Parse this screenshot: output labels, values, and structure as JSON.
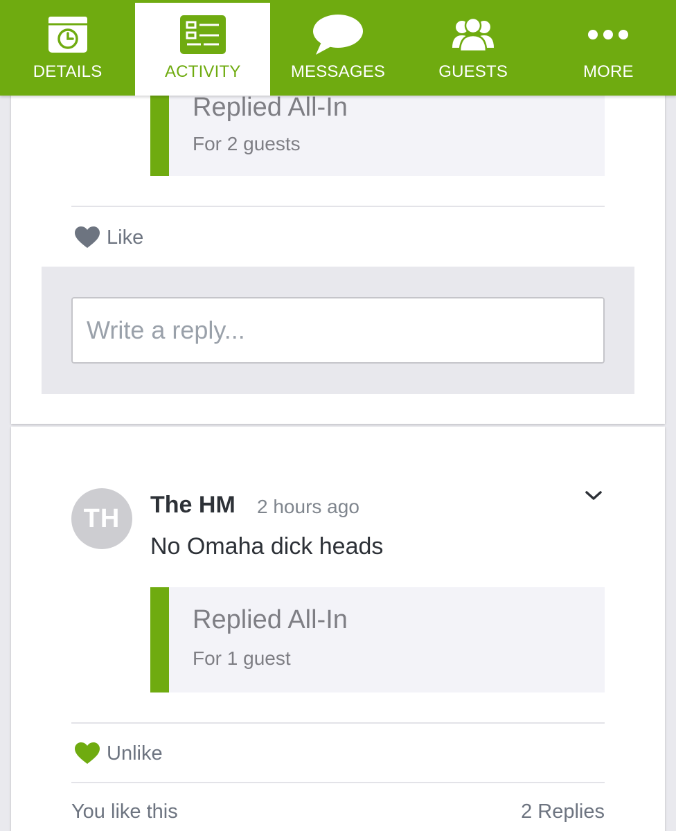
{
  "colors": {
    "brand_green": "#6fab10",
    "status_bg": "#f3f3f8",
    "muted_text": "#7e7e84"
  },
  "nav": {
    "tabs": [
      {
        "label": "DETAILS",
        "icon": "calendar-clock-icon",
        "active": false
      },
      {
        "label": "ACTIVITY",
        "icon": "activity-feed-icon",
        "active": true
      },
      {
        "label": "MESSAGES",
        "icon": "speech-bubble-icon",
        "active": false
      },
      {
        "label": "GUESTS",
        "icon": "guests-group-icon",
        "active": false
      },
      {
        "label": "MORE",
        "icon": "more-dots-icon",
        "active": false
      }
    ]
  },
  "post1": {
    "status_title": "Replied All-In",
    "status_sub": "For 2 guests",
    "like_label": "Like",
    "liked": false,
    "reply_placeholder": "Write a reply..."
  },
  "post2": {
    "avatar_initials": "TH",
    "author": "The HM",
    "time": "2 hours ago",
    "text": "No Omaha dick heads",
    "status_title": "Replied All-In",
    "status_sub": "For 1 guest",
    "like_label": "Unlike",
    "liked": true,
    "likes_summary": "You like this",
    "replies_count": "2 Replies"
  }
}
